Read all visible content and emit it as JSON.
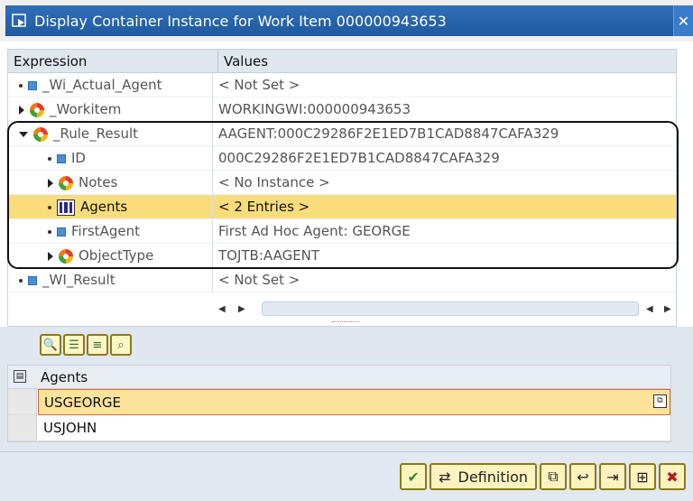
{
  "window": {
    "title": "Display Container Instance for Work Item 000000943653"
  },
  "tree": {
    "columns": {
      "expression": "Expression",
      "values": "Values"
    },
    "rows": [
      {
        "name": "_Wi_Actual_Agent",
        "value": "< Not Set >"
      },
      {
        "name": "_Workitem",
        "value": "WORKINGWI:000000943653"
      },
      {
        "name": "_Rule_Result",
        "value": "AAGENT:000C29286F2E1ED7B1CAD8847CAFA329"
      },
      {
        "name": "ID",
        "value": "000C29286F2E1ED7B1CAD8847CAFA329"
      },
      {
        "name": "Notes",
        "value": "< No Instance >"
      },
      {
        "name": "Agents",
        "value": "< 2 Entries >"
      },
      {
        "name": "FirstAgent",
        "value": "First Ad Hoc Agent: GEORGE"
      },
      {
        "name": "ObjectType",
        "value": "TOJTB:AAGENT"
      },
      {
        "name": "_WI_Result",
        "value": "< Not Set >"
      }
    ]
  },
  "grid": {
    "header": "Agents",
    "rows": [
      "USGEORGE",
      "USJOHN"
    ]
  },
  "footer": {
    "definition_label": "Definition"
  },
  "colors": {
    "selected_row": "#f9dc7c",
    "title_bar": "#2f6fb8"
  }
}
